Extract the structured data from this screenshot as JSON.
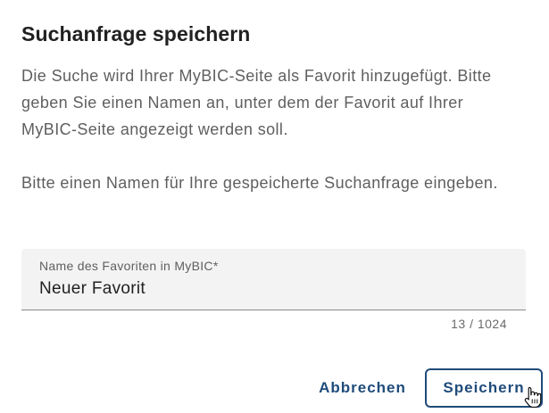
{
  "dialog": {
    "title": "Suchanfrage speichern",
    "paragraph_1": "Die Suche wird Ihrer MyBIC-Seite als Favorit hinzugefügt. Bitte geben Sie einen Namen an, unter dem der Favorit auf Ihrer MyBIC-Seite angezeigt werden soll.",
    "paragraph_2": "Bitte einen Namen für Ihre gespeicherte Suchanfrage eingeben."
  },
  "field": {
    "label": "Name des Favoriten in MyBIC*",
    "value": "Neuer Favorit",
    "counter": "13 / 1024"
  },
  "actions": {
    "cancel_label": "Abbrechen",
    "save_label": "Speichern"
  },
  "icons": {
    "cursor": "hand-pointer-icon"
  },
  "colors": {
    "accent": "#1f4b7a",
    "text_primary": "#212121",
    "text_secondary": "#5f5f5f",
    "field_background": "#f3f3f3"
  }
}
